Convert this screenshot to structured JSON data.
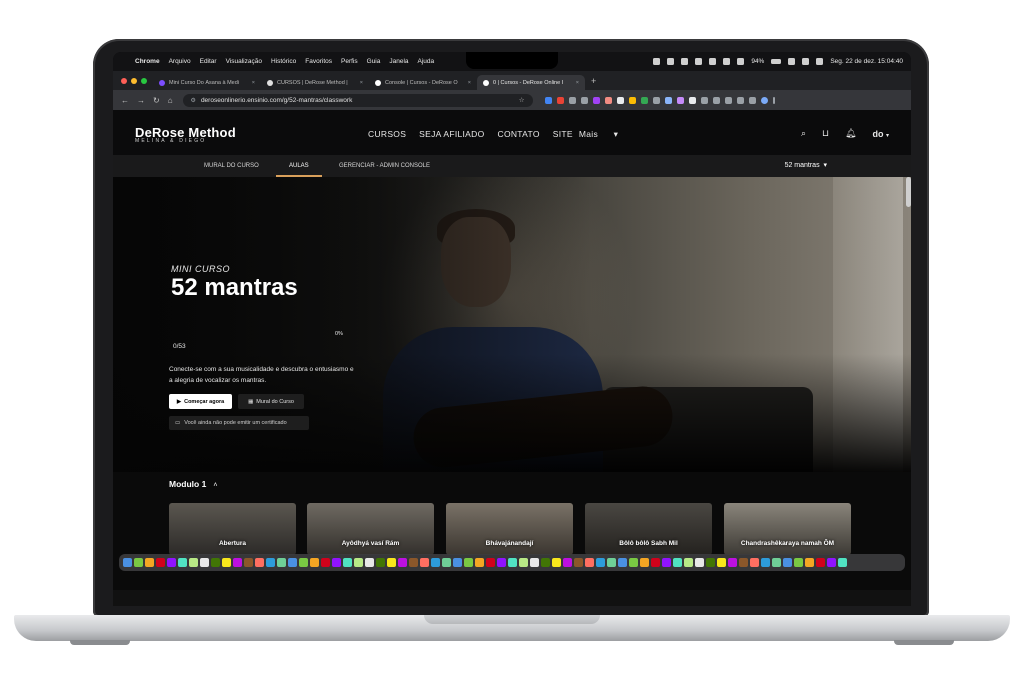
{
  "menubar": {
    "items": [
      "Chrome",
      "Arquivo",
      "Editar",
      "Visualização",
      "Histórico",
      "Favoritos",
      "Perfis",
      "Guia",
      "Janela",
      "Ajuda"
    ],
    "battery": "94%",
    "datetime": "Seg. 22 de dez.  15:04:40"
  },
  "browser": {
    "tabs": [
      {
        "title": "Mini Curso Do Ásana à Medi",
        "active": false
      },
      {
        "title": "CURSOS | DeRose Method |",
        "active": false
      },
      {
        "title": "Console | Cursos - DeRose O",
        "active": false
      },
      {
        "title": "0 | Cursos - DeRose Online I",
        "active": true
      }
    ],
    "url": "deroseonlinerio.ensinio.com/g/52-mantras/classwork"
  },
  "site": {
    "logo": "DeRose Method",
    "logo_sub": "MELINA & DIEGO",
    "nav": [
      "CURSOS",
      "SEJA AFILIADO",
      "CONTATO",
      "SITE",
      "Mais"
    ],
    "avatar_initials": "do"
  },
  "subnav": {
    "items": [
      "MURAL DO CURSO",
      "AULAS",
      "GERENCIAR - ADMIN CONSOLE"
    ],
    "active": "AULAS",
    "course_selector": "52 mantras"
  },
  "hero": {
    "kicker": "MINI CURSO",
    "title": "52 mantras",
    "progress_count": "0/53",
    "progress_percent": "0%",
    "description": "Conecte-se com a sua musicalidade e descubra o entusiasmo e a alegria de vocalizar os mantras.",
    "start_button": "Começar agora",
    "mural_button": "Mural do Curso",
    "certificate_note": "Você ainda não pode emitir um certificado"
  },
  "module": {
    "title": "Modulo 1",
    "lessons": [
      "Abertura",
      "Ayôdhyá vasí Rám",
      "Bhávajánandají",
      "Bôlô bôlô Sabh Mil",
      "Chandrashêkaraya namah ÔM"
    ]
  },
  "colors": {
    "accent": "#d9a05b",
    "background": "#0b0b0c",
    "subnav_bg": "#1a1a1b"
  }
}
